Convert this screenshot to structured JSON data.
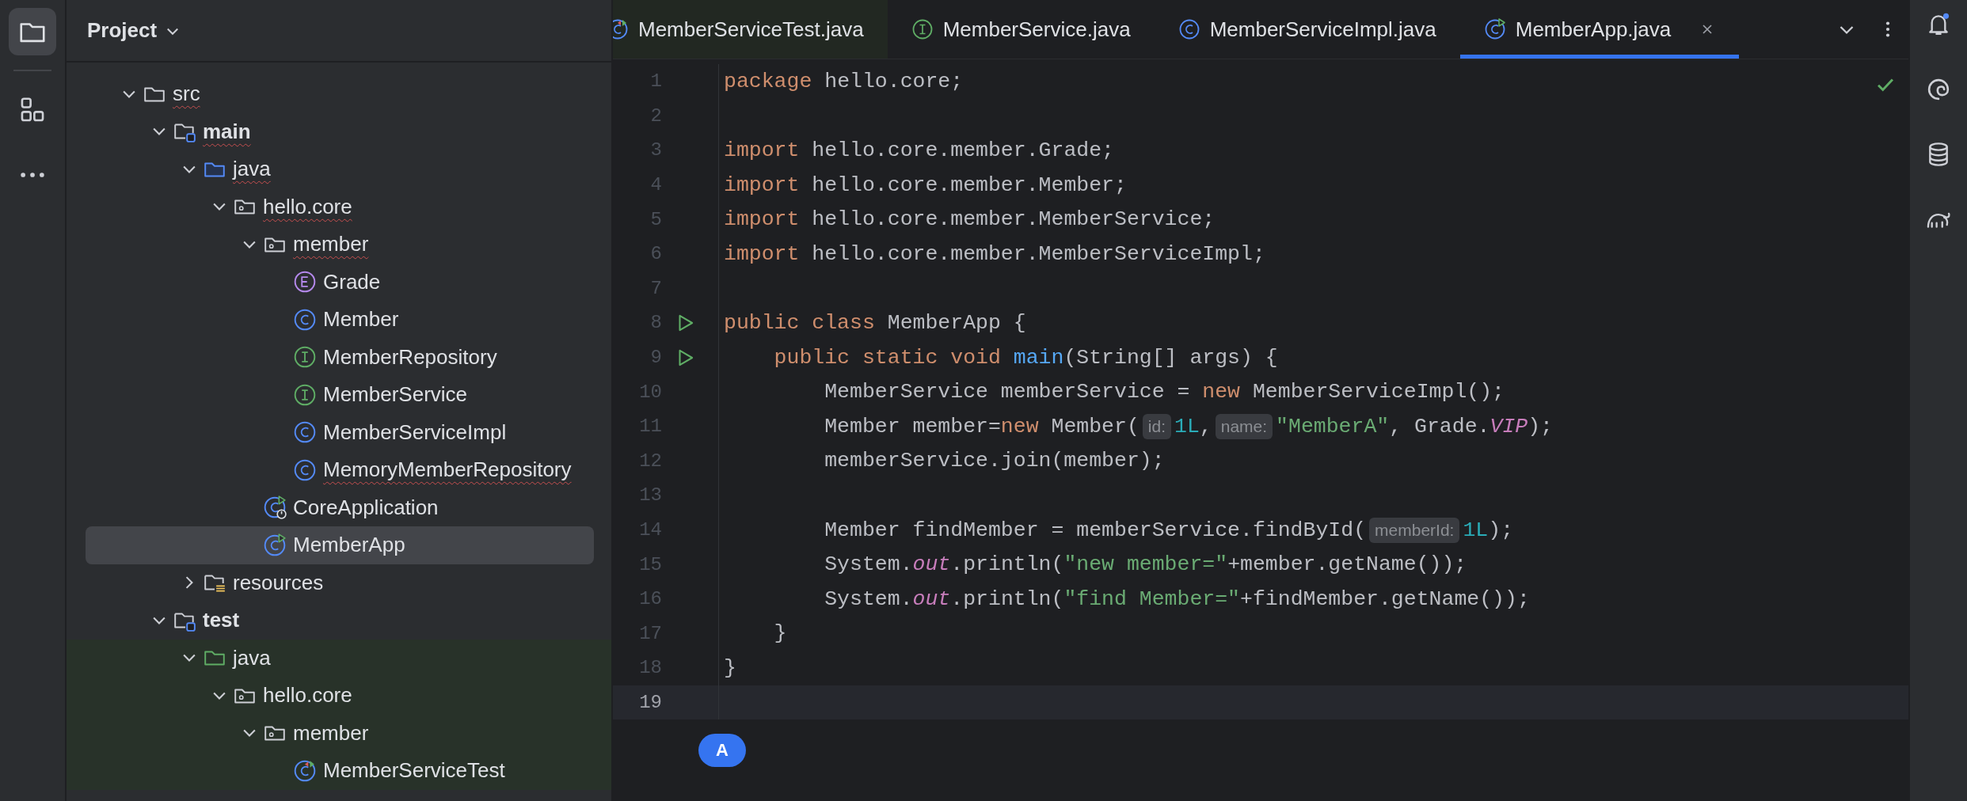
{
  "panel": {
    "title": "Project"
  },
  "tree": [
    {
      "label": "src",
      "kind": "folder",
      "expanded": true,
      "selected": false,
      "error": true,
      "children": [
        {
          "label": "main",
          "kind": "module",
          "expanded": true,
          "selected": false,
          "error": true,
          "children": [
            {
              "label": "java",
              "kind": "source",
              "expanded": true,
              "selected": false,
              "error": true,
              "children": [
                {
                  "label": "hello.core",
                  "kind": "package",
                  "expanded": true,
                  "selected": false,
                  "error": true,
                  "children": [
                    {
                      "label": "member",
                      "kind": "package",
                      "expanded": true,
                      "selected": false,
                      "error": true,
                      "children": [
                        {
                          "label": "Grade",
                          "kind": "enum",
                          "selected": false,
                          "error": false
                        },
                        {
                          "label": "Member",
                          "kind": "class",
                          "selected": false,
                          "error": false
                        },
                        {
                          "label": "MemberRepository",
                          "kind": "interface",
                          "selected": false,
                          "error": false
                        },
                        {
                          "label": "MemberService",
                          "kind": "interface",
                          "selected": false,
                          "error": false
                        },
                        {
                          "label": "MemberServiceImpl",
                          "kind": "class",
                          "selected": false,
                          "error": false
                        },
                        {
                          "label": "MemoryMemberRepository",
                          "kind": "class",
                          "selected": false,
                          "error": true
                        }
                      ]
                    },
                    {
                      "label": "CoreApplication",
                      "kind": "spring",
                      "selected": false,
                      "error": false
                    },
                    {
                      "label": "MemberApp",
                      "kind": "runnable",
                      "selected": true,
                      "error": false
                    }
                  ]
                }
              ]
            },
            {
              "label": "resources",
              "kind": "resources",
              "expanded": false,
              "selected": false,
              "error": false
            }
          ]
        },
        {
          "label": "test",
          "kind": "module",
          "expanded": true,
          "selected": false,
          "error": false,
          "children": [
            {
              "label": "java",
              "kind": "test-source",
              "expanded": true,
              "selected": false,
              "error": false,
              "children": [
                {
                  "label": "hello.core",
                  "kind": "package",
                  "expanded": true,
                  "selected": false,
                  "error": false,
                  "children": [
                    {
                      "label": "member",
                      "kind": "package",
                      "expanded": true,
                      "selected": false,
                      "error": false,
                      "children": [
                        {
                          "label": "MemberServiceTest",
                          "kind": "test-class",
                          "selected": false,
                          "error": false
                        }
                      ]
                    }
                  ]
                }
              ]
            }
          ]
        }
      ]
    }
  ],
  "tabs": [
    {
      "label": "MemberServiceTest.java",
      "kind": "test-class",
      "selected": false
    },
    {
      "label": "MemberService.java",
      "kind": "interface",
      "selected": false
    },
    {
      "label": "MemberServiceImpl.java",
      "kind": "class",
      "selected": false
    },
    {
      "label": "MemberApp.java",
      "kind": "runnable",
      "selected": true
    }
  ],
  "lines": [
    {
      "number": "1",
      "run": false,
      "current": false,
      "tokens": [
        {
          "kind": "keyword",
          "text": "package"
        },
        {
          "kind": "plain",
          "text": " hello.core;"
        }
      ]
    },
    {
      "number": "2",
      "run": false,
      "current": false
    },
    {
      "number": "3",
      "run": false,
      "current": false,
      "tokens": [
        {
          "kind": "keyword",
          "text": "import"
        },
        {
          "kind": "plain",
          "text": " hello.core.member.Grade;"
        }
      ]
    },
    {
      "number": "4",
      "run": false,
      "current": false,
      "tokens": [
        {
          "kind": "keyword",
          "text": "import"
        },
        {
          "kind": "plain",
          "text": " hello.core.member.Member;"
        }
      ]
    },
    {
      "number": "5",
      "run": false,
      "current": false,
      "tokens": [
        {
          "kind": "keyword",
          "text": "import"
        },
        {
          "kind": "plain",
          "text": " hello.core.member.MemberService;"
        }
      ]
    },
    {
      "number": "6",
      "run": false,
      "current": false,
      "tokens": [
        {
          "kind": "keyword",
          "text": "import"
        },
        {
          "kind": "plain",
          "text": " hello.core.member.MemberServiceImpl;"
        }
      ]
    },
    {
      "number": "7",
      "run": false,
      "current": false
    },
    {
      "number": "8",
      "run": true,
      "current": false,
      "tokens": [
        {
          "kind": "keyword",
          "text": "public class"
        },
        {
          "kind": "plain",
          "text": " MemberApp {"
        }
      ]
    },
    {
      "number": "9",
      "run": true,
      "current": false,
      "tokens": [
        {
          "kind": "keyword",
          "text": "    public static void "
        },
        {
          "kind": "function",
          "text": "main"
        },
        {
          "kind": "plain",
          "text": "(String[] args) {"
        }
      ]
    },
    {
      "number": "10",
      "run": false,
      "current": false,
      "tokens": [
        {
          "kind": "plain",
          "text": "        MemberService memberService = "
        },
        {
          "kind": "keyword",
          "text": "new"
        },
        {
          "kind": "plain",
          "text": " MemberServiceImpl();"
        }
      ]
    },
    {
      "number": "11",
      "run": false,
      "current": false,
      "tokens": [
        {
          "kind": "plain",
          "text": "        Member member="
        },
        {
          "kind": "keyword",
          "text": "new"
        },
        {
          "kind": "plain",
          "text": " Member("
        },
        {
          "kind": "hint",
          "text": "id:"
        },
        {
          "kind": "number",
          "text": "1L"
        },
        {
          "kind": "plain",
          "text": ","
        },
        {
          "kind": "hint",
          "text": "name:"
        },
        {
          "kind": "string",
          "text": "\"MemberA\""
        },
        {
          "kind": "plain",
          "text": ", Grade."
        },
        {
          "kind": "static",
          "text": "VIP"
        },
        {
          "kind": "plain",
          "text": ");"
        }
      ]
    },
    {
      "number": "12",
      "run": false,
      "current": false,
      "tokens": [
        {
          "kind": "plain",
          "text": "        memberService.join(member);"
        }
      ]
    },
    {
      "number": "13",
      "run": false,
      "current": false
    },
    {
      "number": "14",
      "run": false,
      "current": false,
      "tokens": [
        {
          "kind": "plain",
          "text": "        Member findMember = memberService.findById("
        },
        {
          "kind": "hint",
          "text": "memberId:"
        },
        {
          "kind": "number",
          "text": "1L"
        },
        {
          "kind": "plain",
          "text": ");"
        }
      ]
    },
    {
      "number": "15",
      "run": false,
      "current": false,
      "tokens": [
        {
          "kind": "plain",
          "text": "        System."
        },
        {
          "kind": "static",
          "text": "out"
        },
        {
          "kind": "plain",
          "text": ".println("
        },
        {
          "kind": "string",
          "text": "\"new member=\""
        },
        {
          "kind": "plain",
          "text": "+member.getName());"
        }
      ]
    },
    {
      "number": "16",
      "run": false,
      "current": false,
      "tokens": [
        {
          "kind": "plain",
          "text": "        System."
        },
        {
          "kind": "static",
          "text": "out"
        },
        {
          "kind": "plain",
          "text": ".println("
        },
        {
          "kind": "string",
          "text": "\"find Member=\""
        },
        {
          "kind": "plain",
          "text": "+findMember.getName());"
        }
      ]
    },
    {
      "number": "17",
      "run": false,
      "current": false,
      "tokens": [
        {
          "kind": "plain",
          "text": "    }"
        }
      ]
    },
    {
      "number": "18",
      "run": false,
      "current": false,
      "tokens": [
        {
          "kind": "plain",
          "text": "}"
        }
      ]
    },
    {
      "number": "19",
      "run": false,
      "current": true
    }
  ],
  "assistant_badge": "A"
}
